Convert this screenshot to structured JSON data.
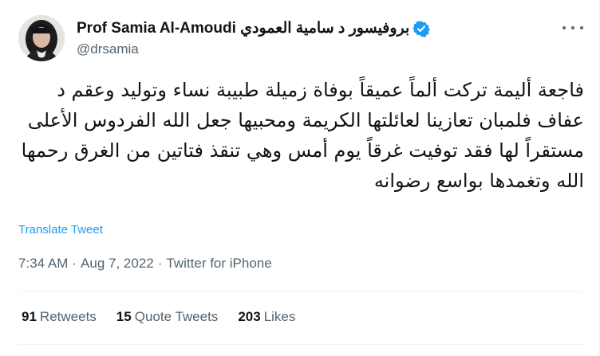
{
  "author": {
    "name": "Prof Samia Al-Amoudi بروفيسور د سامية العمودي",
    "handle": "@drsamia",
    "verified": true
  },
  "tweet": {
    "text": "فاجعة أليمة تركت ألماً عميقاً بوفاة زميلة طبيبة نساء وتوليد وعقم د عفاف فلمبان تعازينا لعائلتها الكريمة ومحبيها جعل الله الفردوس الأعلى مستقراً لها فقد توفيت غرقاً يوم أمس وهي تنقذ فتاتين من الغرق رحمها الله وتغمدها بواسع رضوانه",
    "translate_label": "Translate Tweet",
    "time": "7:34 AM",
    "separator": "·",
    "date": "Aug 7, 2022",
    "source": "Twitter for iPhone"
  },
  "stats": {
    "retweets_count": "91",
    "retweets_label": "Retweets",
    "quote_count": "15",
    "quote_label": "Quote Tweets",
    "likes_count": "203",
    "likes_label": "Likes"
  },
  "icons": {
    "verified": "verified-badge-icon",
    "more": "more-dots-icon"
  },
  "colors": {
    "accent": "#1d9bf0",
    "text": "#0f1419",
    "secondary": "#536471",
    "divider": "#eff3f4"
  }
}
